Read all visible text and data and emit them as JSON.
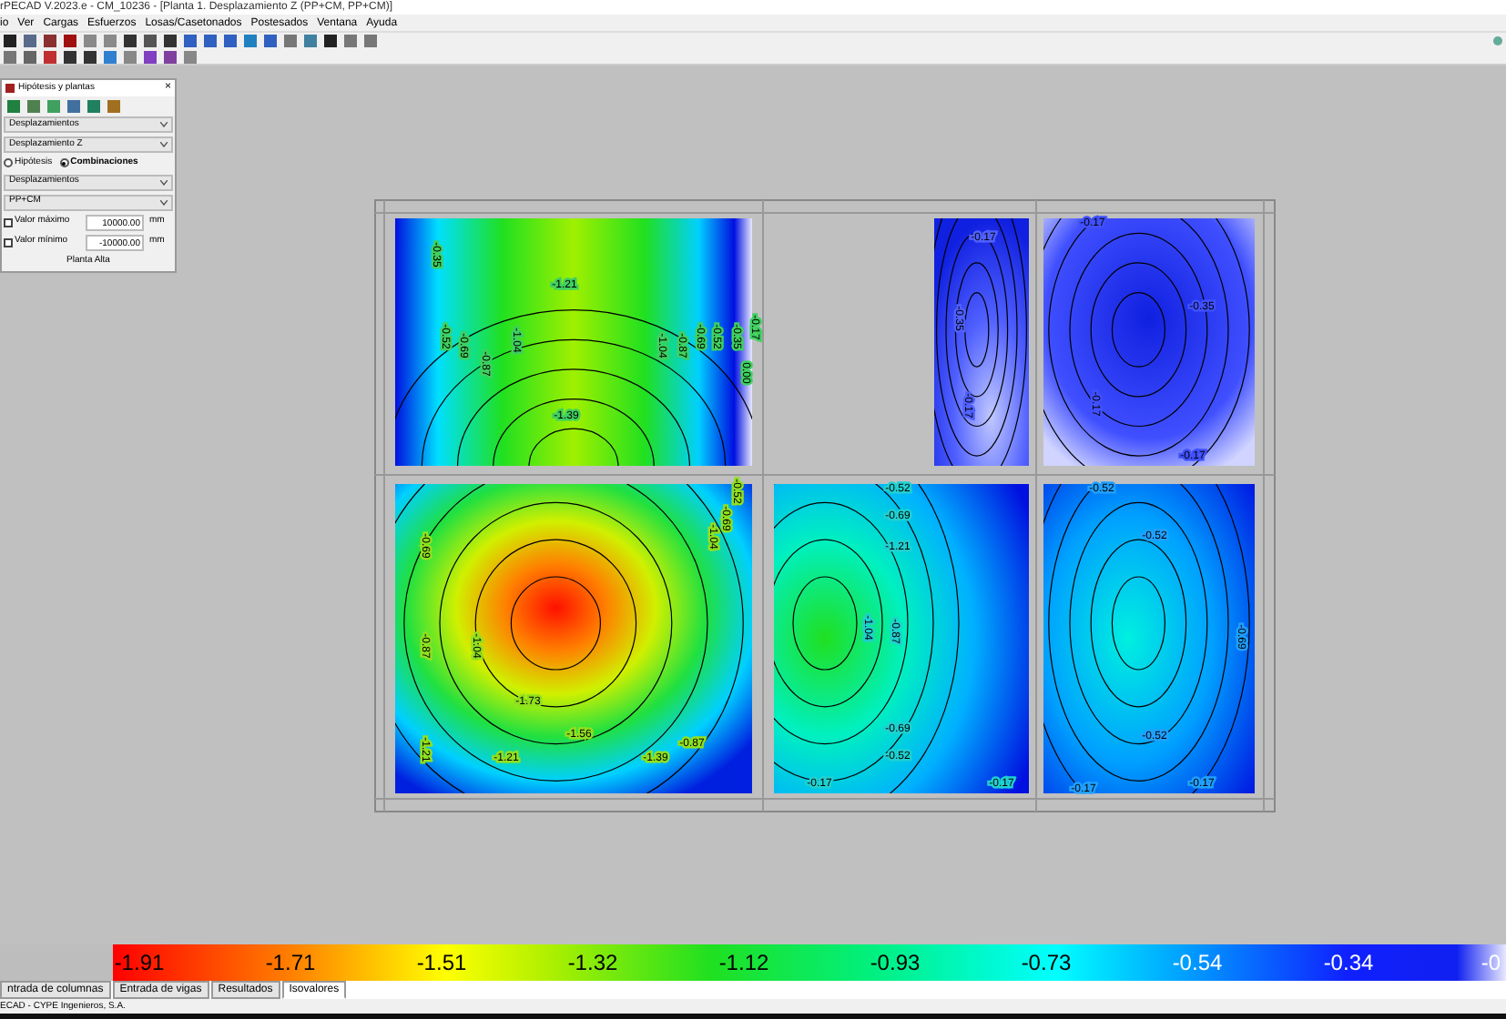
{
  "window": {
    "title": "rPECAD V.2023.e - CM_10236 - [Planta 1. Desplazamiento Z (PP+CM, PP+CM)]"
  },
  "menu": [
    "io",
    "Ver",
    "Cargas",
    "Esfuerzos",
    "Losas/Casetonados",
    "Postesados",
    "Ventana",
    "Ayuda"
  ],
  "dialog": {
    "title": "Hipótesis y plantas",
    "close": "×",
    "select_1": "Desplazamientos",
    "select_2": "Desplazamiento Z",
    "radios": [
      {
        "label": "Hipótesis",
        "selected": false
      },
      {
        "label": "Combinaciones",
        "selected": true
      }
    ],
    "select_3": "Desplazamientos",
    "select_4": "PP+CM",
    "limits": [
      {
        "label": "Valor máximo",
        "checked": false,
        "value": "10000.00",
        "unit": "mm"
      },
      {
        "label": "Valor mínimo",
        "checked": false,
        "value": "-10000.00",
        "unit": "mm"
      }
    ],
    "floor": "Planta Alta"
  },
  "panels": [
    {
      "labels": [
        "-0.35",
        "-0.52",
        "-0.69",
        "-0.87",
        "-1.04",
        "-1.21",
        "-1.39",
        "-1.04",
        "-0.87",
        "-0.69",
        "-0.52",
        "-0.35",
        "-0.17",
        "0.00"
      ]
    },
    {
      "labels": [
        "-0.17",
        "-0.35",
        "-0.17"
      ]
    },
    {
      "labels": [
        "-0.17",
        "-0.35",
        "-0.17",
        "-0.17"
      ]
    },
    {
      "labels": [
        "-0.69",
        "-0.87",
        "-1.04",
        "-1.73",
        "-1.56",
        "-1.39",
        "-1.21",
        "-0.69",
        "-0.52",
        "-1.04",
        "-0.87",
        "-1.21"
      ]
    },
    {
      "labels": [
        "-0.52",
        "-0.69",
        "-1.21",
        "-1.04",
        "-0.87",
        "-0.69",
        "-0.52",
        "-0.17",
        "-0.17"
      ]
    },
    {
      "labels": [
        "-0.52",
        "-0.52",
        "-0.69",
        "-0.52",
        "-0.17",
        "-0.17"
      ]
    }
  ],
  "legend": [
    "-1.91",
    "-1.71",
    "-1.51",
    "-1.32",
    "-1.12",
    "-0.93",
    "-0.73",
    "-0.54",
    "-0.34",
    "-0"
  ],
  "tabs": [
    {
      "label": "ntrada de columnas",
      "selected": false
    },
    {
      "label": "Entrada de vigas",
      "selected": false
    },
    {
      "label": "Resultados",
      "selected": false
    },
    {
      "label": "Isovalores",
      "selected": true
    }
  ],
  "status_bar": "ECAD - CYPE Ingenieros, S.A."
}
